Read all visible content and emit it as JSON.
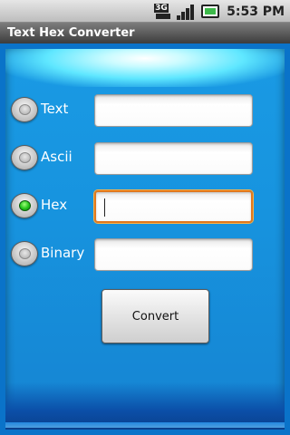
{
  "status_bar": {
    "network_label": "3G",
    "time": "5:53 PM",
    "icons": [
      "3g-data-icon",
      "signal-strength-icon",
      "battery-charging-icon"
    ]
  },
  "app": {
    "title": "Text Hex Converter"
  },
  "rows": [
    {
      "label": "Text",
      "checked": false,
      "value": "",
      "focused": false
    },
    {
      "label": "Ascii",
      "checked": false,
      "value": "",
      "focused": false
    },
    {
      "label": "Hex",
      "checked": true,
      "value": "",
      "focused": true
    },
    {
      "label": "Binary",
      "checked": false,
      "value": "",
      "focused": false
    }
  ],
  "convert_button": {
    "label": "Convert"
  },
  "colors": {
    "panel_blue": "#1794df",
    "focus_orange": "#e0781d",
    "radio_checked_green": "#22c21a"
  }
}
